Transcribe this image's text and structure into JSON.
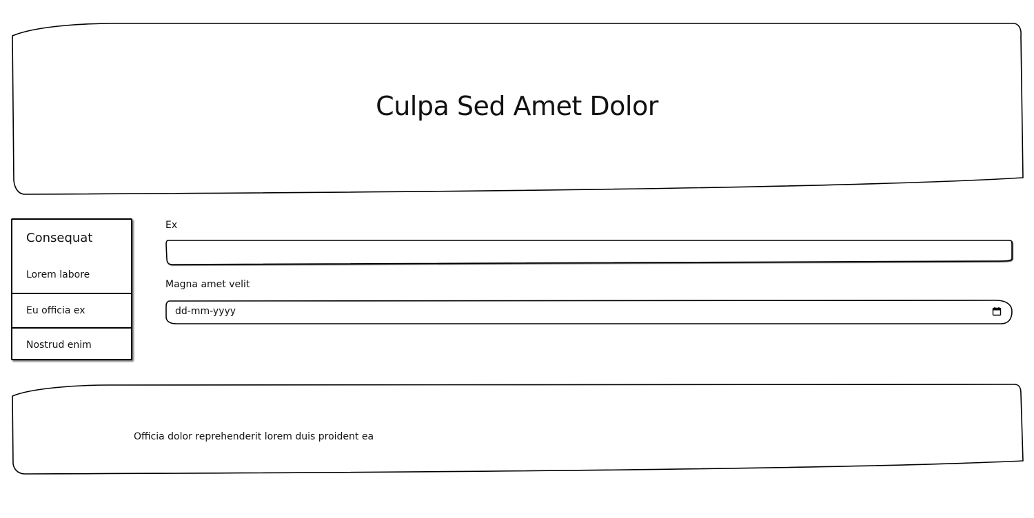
{
  "header": {
    "title": "Culpa Sed Amet Dolor"
  },
  "sidebar": {
    "title": "Consequat",
    "items": [
      {
        "label": "Lorem labore"
      },
      {
        "label": "Eu officia ex"
      },
      {
        "label": "Nostrud enim"
      }
    ]
  },
  "form": {
    "field_1": {
      "label": "Ex",
      "value": "",
      "placeholder": ""
    },
    "field_2": {
      "label": "Magna amet velit",
      "value": "dd-mm-yyyy",
      "icon": "calendar-icon"
    }
  },
  "footer": {
    "text": "Officia dolor reprehenderit lorem duis proident ea"
  },
  "colors": {
    "border": "#000000",
    "background": "#ffffff",
    "text": "#111111"
  }
}
